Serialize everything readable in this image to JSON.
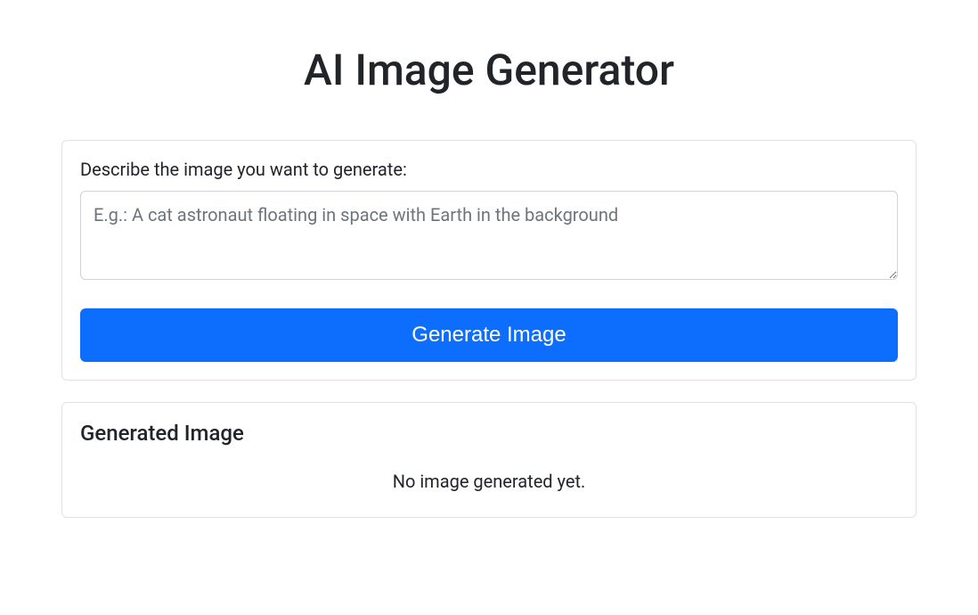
{
  "header": {
    "title": "AI Image Generator"
  },
  "prompt_card": {
    "label": "Describe the image you want to generate:",
    "placeholder": "E.g.: A cat astronaut floating in space with Earth in the background",
    "value": "",
    "button_label": "Generate Image"
  },
  "result_card": {
    "heading": "Generated Image",
    "empty_message": "No image generated yet."
  }
}
